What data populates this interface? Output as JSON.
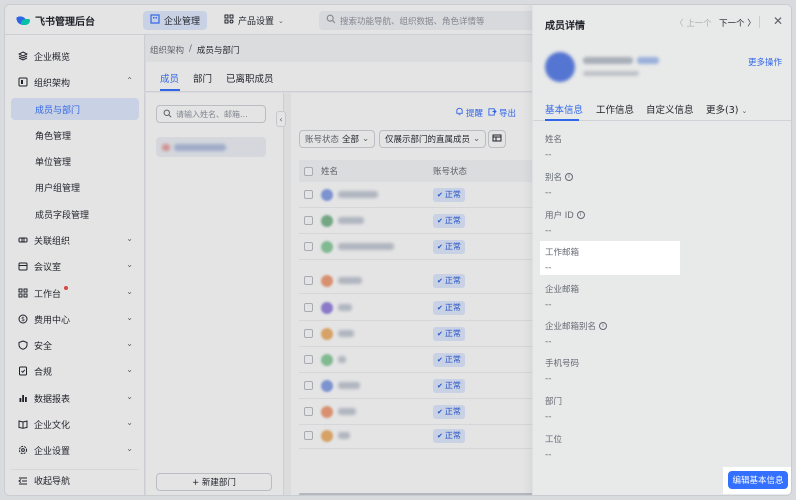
{
  "app": {
    "title": "飞书管理后台"
  },
  "topbar": {
    "tabs": [
      {
        "label": "企业管理",
        "icon": "building-icon"
      },
      {
        "label": "产品设置",
        "icon": "grid-settings-icon"
      }
    ],
    "search_placeholder": "搜索功能导航、组织数据、角色详情等"
  },
  "sidebar": {
    "items": [
      {
        "label": "企业概览",
        "icon": "layers-icon"
      },
      {
        "label": "组织架构",
        "icon": "org-icon",
        "expanded": true
      },
      {
        "label": "成员与部门",
        "selected": true
      },
      {
        "label": "角色管理"
      },
      {
        "label": "单位管理"
      },
      {
        "label": "用户组管理"
      },
      {
        "label": "成员字段管理"
      },
      {
        "label": "关联组织",
        "icon": "link-icon"
      },
      {
        "label": "会议室",
        "icon": "calendar-icon"
      },
      {
        "label": "工作台",
        "icon": "apps-icon",
        "badge": true
      },
      {
        "label": "费用中心",
        "icon": "dollar-icon"
      },
      {
        "label": "安全",
        "icon": "shield-icon"
      },
      {
        "label": "合规",
        "icon": "doc-check-icon"
      },
      {
        "label": "数据报表",
        "icon": "bar-chart-icon"
      },
      {
        "label": "企业文化",
        "icon": "book-icon"
      },
      {
        "label": "企业设置",
        "icon": "gear-icon"
      }
    ],
    "collapse_label": "收起导航"
  },
  "main": {
    "breadcrumb": [
      "组织架构",
      "成员与部门"
    ],
    "tabs": [
      "成员",
      "部门",
      "已离职成员"
    ],
    "search_placeholder": "请输入姓名、邮箱...",
    "new_dept_label": "+ 新建部门",
    "toolbar": {
      "remind": "提醒",
      "export": "导出"
    },
    "filters": {
      "account_status_label": "账号状态",
      "account_status_value": "全部",
      "scope": "仅展示部门的直属成员"
    },
    "table": {
      "columns": [
        "姓名",
        "账号状态"
      ],
      "status": [
        "正常",
        "正常",
        "正常",
        "正常",
        "正常",
        "正常",
        "正常",
        "正常",
        "正常",
        "正常"
      ],
      "avatar_colors": [
        "#8aa3e8",
        "#7fb98f",
        "#8fcfa0",
        "#f2a07a",
        "#9a86e0",
        "#f0b46e",
        "#8fcfa0",
        "#8aa3e8",
        "#f2a07a",
        "#f0b46e"
      ]
    }
  },
  "drawer": {
    "title": "成员详情",
    "prev": "上一个",
    "next": "下一个",
    "more_ops": "更多操作",
    "tabs": [
      "基本信息",
      "工作信息",
      "自定义信息",
      "更多(3)"
    ],
    "fields": [
      {
        "label": "姓名",
        "value": "--"
      },
      {
        "label": "别名",
        "value": "--",
        "info": true
      },
      {
        "label": "用户 ID",
        "value": "--",
        "info": true
      },
      {
        "label": "工作邮箱",
        "value": "--"
      },
      {
        "label": "企业邮箱",
        "value": "--"
      },
      {
        "label": "企业邮箱别名",
        "value": "--",
        "info": true
      },
      {
        "label": "手机号码",
        "value": "--"
      },
      {
        "label": "部门",
        "value": "--"
      },
      {
        "label": "工位",
        "value": "--"
      }
    ],
    "edit_button": "编辑基本信息"
  }
}
